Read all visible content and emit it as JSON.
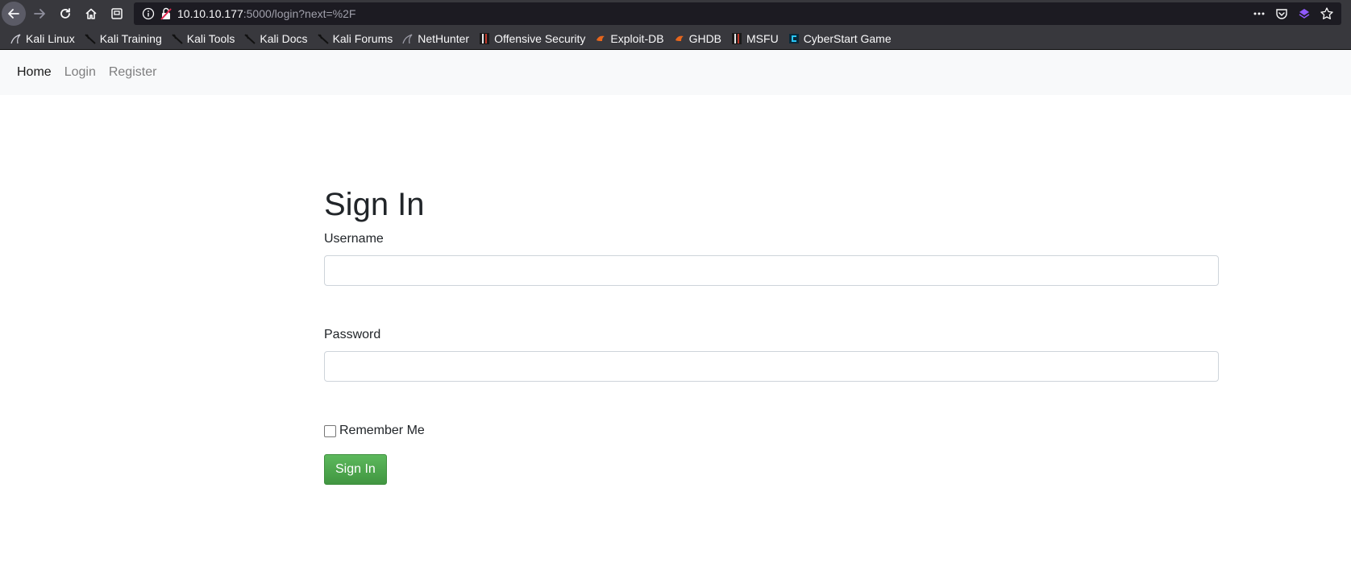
{
  "browser": {
    "url_host": "10.10.10.177",
    "url_path": ":5000/login?next=%2F"
  },
  "bookmarks": [
    {
      "label": "Kali Linux",
      "icon": "kali-dragon-icon"
    },
    {
      "label": "Kali Training",
      "icon": "kali-dragon-icon"
    },
    {
      "label": "Kali Tools",
      "icon": "kali-dragon-icon"
    },
    {
      "label": "Kali Docs",
      "icon": "kali-dragon-icon"
    },
    {
      "label": "Kali Forums",
      "icon": "kali-dragon-icon"
    },
    {
      "label": "NetHunter",
      "icon": "nethunter-icon"
    },
    {
      "label": "Offensive Security",
      "icon": "offsec-icon"
    },
    {
      "label": "Exploit-DB",
      "icon": "exploit-db-icon"
    },
    {
      "label": "GHDB",
      "icon": "ghdb-icon"
    },
    {
      "label": "MSFU",
      "icon": "msfu-icon"
    },
    {
      "label": "CyberStart Game",
      "icon": "cyberstart-icon"
    }
  ],
  "nav": {
    "home": "Home",
    "login": "Login",
    "register": "Register"
  },
  "form": {
    "title": "Sign In",
    "username_label": "Username",
    "username_value": "",
    "password_label": "Password",
    "password_value": "",
    "remember_label": "Remember Me",
    "submit_label": "Sign In"
  },
  "colors": {
    "submit_button": "#5cb85c",
    "toolbar": "#38383d"
  }
}
